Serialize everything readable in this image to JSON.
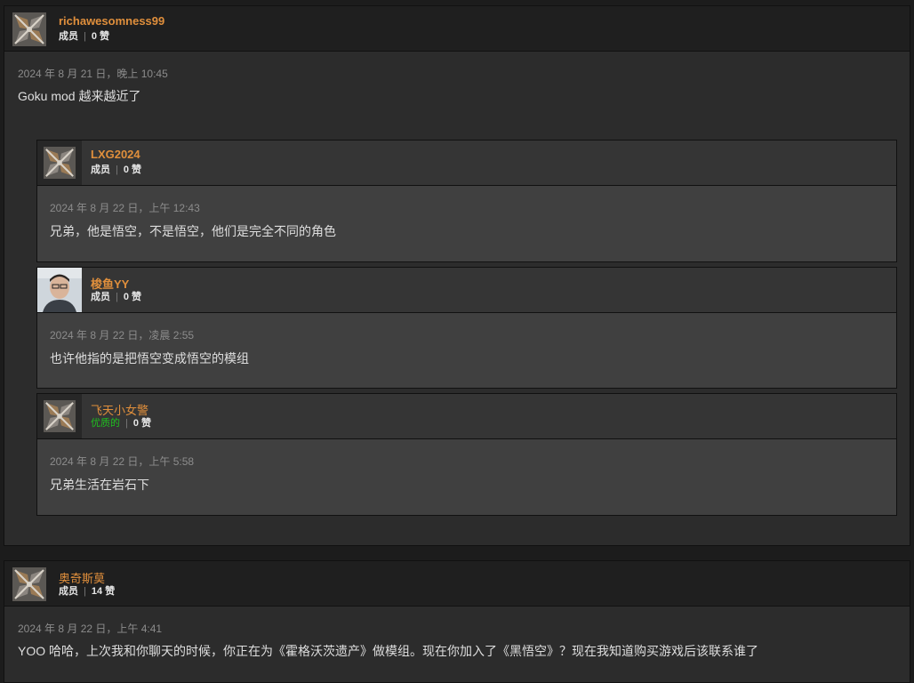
{
  "comments": [
    {
      "username": "richawesomness99",
      "rank": "成员",
      "likes": "0 赞",
      "date": "2024 年 8 月 21 日，晚上 10:45",
      "text": "Goku mod 越来越近了",
      "replies": [
        {
          "username": "LXG2024",
          "rank": "成员",
          "likes": "0 赞",
          "date": "2024 年 8 月 22 日，上午 12:43",
          "text": "兄弟，他是悟空，不是悟空，他们是完全不同的角色"
        },
        {
          "username": "梭鱼YY",
          "rank": "成员",
          "likes": "0 赞",
          "date": "2024 年 8 月 22 日，凌晨 2:55",
          "text": "也许他指的是把悟空变成悟空的模组"
        },
        {
          "username": "飞天小女警",
          "rank": "优质的",
          "likes": "0 赞",
          "date": "2024 年 8 月 22 日，上午 5:58",
          "text": "兄弟生活在岩石下"
        }
      ]
    },
    {
      "username": "奥奇斯莫",
      "rank": "成员",
      "likes": "14 赞",
      "date": "2024 年 8 月 22 日，上午 4:41",
      "text": "YOO 哈哈，上次我和你聊天的时候，你正在为《霍格沃茨遗产》做模组。现在你加入了《黑悟空》？现在我知道购买游戏后该联系谁了"
    }
  ],
  "colors": {
    "username": "#e08f3c",
    "premium_rank": "#1fbf1f",
    "page_bg": "#1c1c1c",
    "reply_bg": "#404040"
  },
  "icons": {
    "default_avatar": "nexus-default-avatar-icon",
    "photo_avatar": "user-photo-avatar"
  }
}
